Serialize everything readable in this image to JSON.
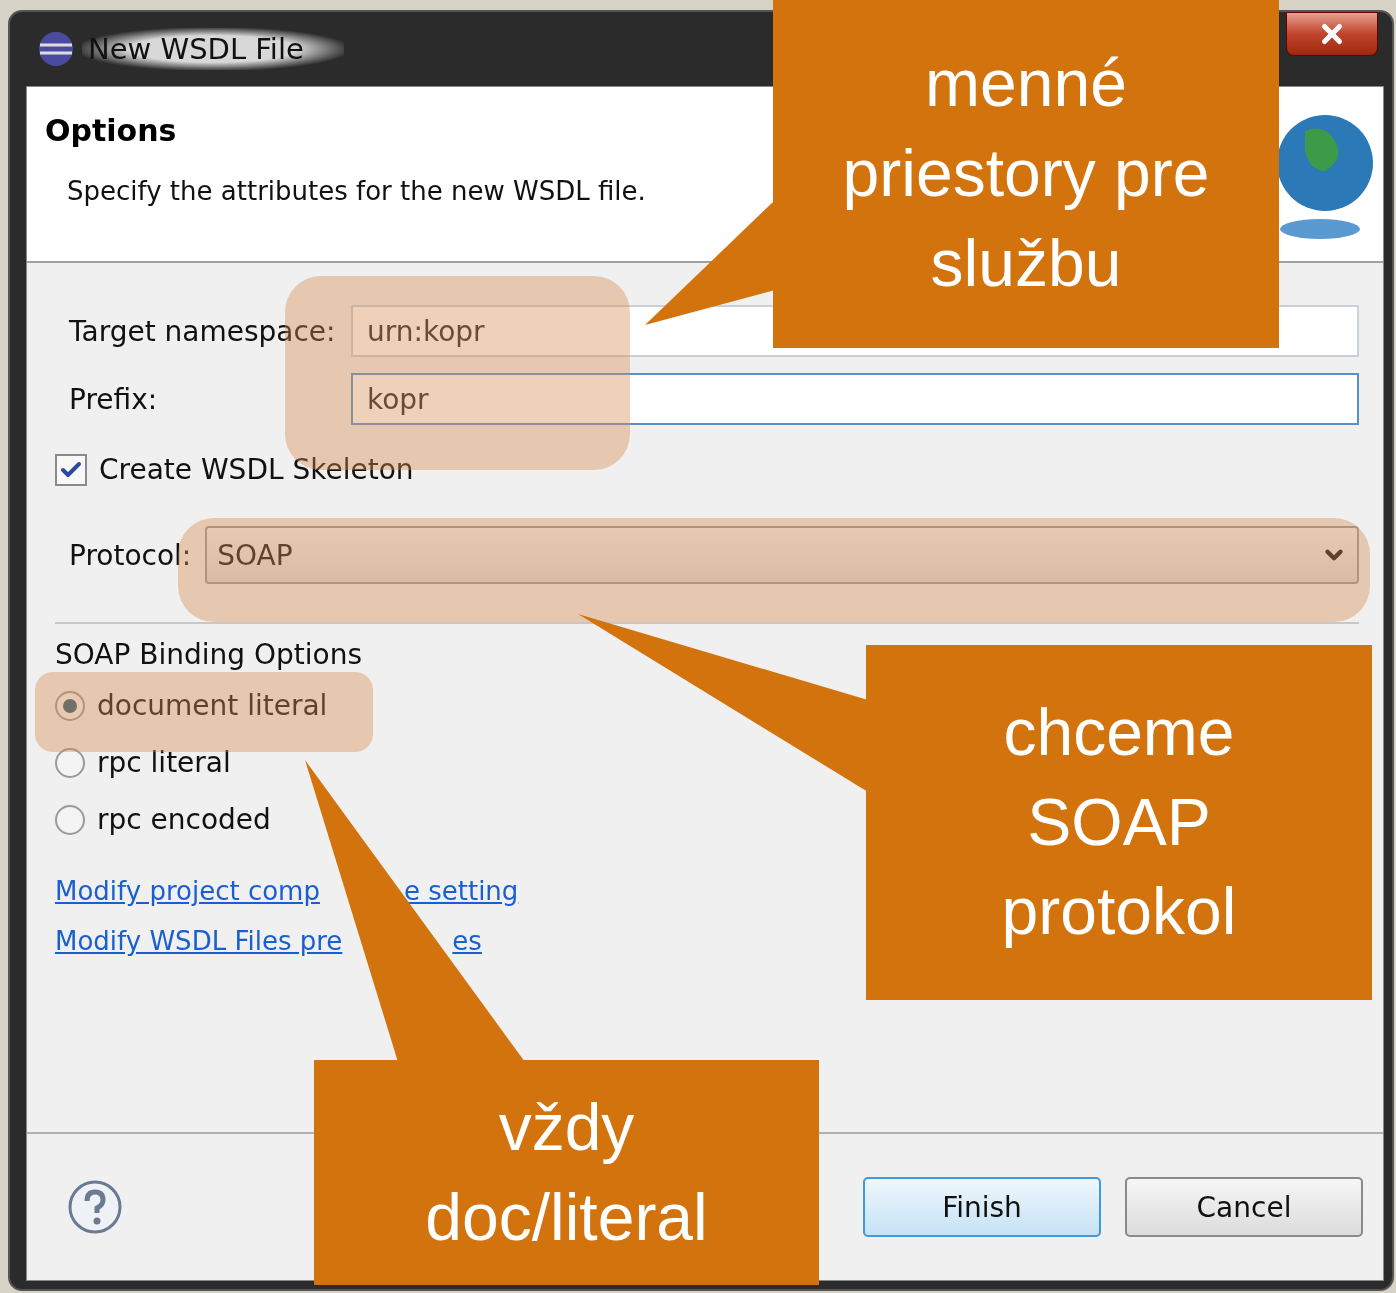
{
  "window": {
    "title": "New WSDL File"
  },
  "header": {
    "title": "Options",
    "description": "Specify the attributes for the new WSDL file."
  },
  "fields": [
    {
      "label": "Target namespace:",
      "value": "urn:kopr",
      "focused": false
    },
    {
      "label": "Prefix:",
      "value": "kopr",
      "focused": true
    }
  ],
  "skeleton": {
    "label": "Create WSDL Skeleton",
    "checked": true
  },
  "protocol": {
    "label": "Protocol:",
    "value": "SOAP"
  },
  "binding": {
    "title": "SOAP Binding Options",
    "options": [
      {
        "label": "document literal",
        "selected": true
      },
      {
        "label": "rpc literal",
        "selected": false
      },
      {
        "label": "rpc encoded",
        "selected": false
      }
    ]
  },
  "links": [
    {
      "parts": [
        "Modify project comp",
        "e setting"
      ]
    },
    {
      "parts": [
        "Modify WSDL Files pre",
        "es"
      ]
    }
  ],
  "buttons": [
    {
      "label": "Finish",
      "default": true
    },
    {
      "label": "Cancel",
      "default": false
    }
  ],
  "callouts": [
    {
      "text": "menné\npriestory pre\nslužbu"
    },
    {
      "text": "chceme\nSOAP\nprotokol"
    },
    {
      "text": "vždy\ndoc/literal"
    }
  ]
}
